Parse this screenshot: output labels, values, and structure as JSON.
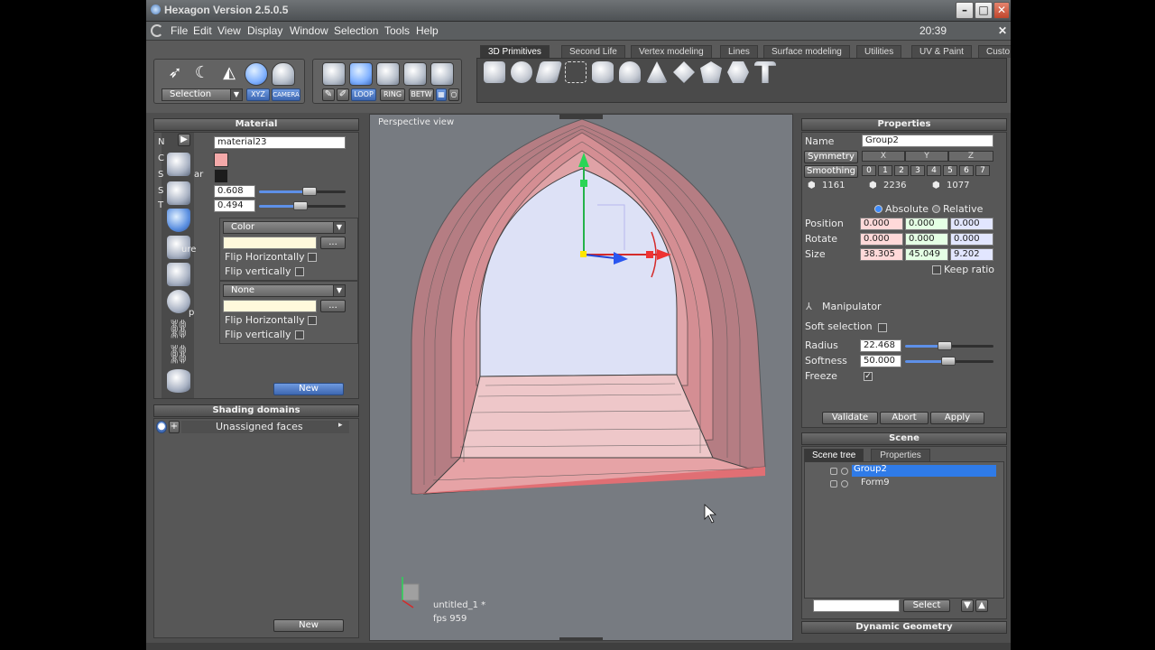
{
  "window": {
    "title": "Hexagon Version 2.5.0.5",
    "clock": "20:39"
  },
  "menu": [
    "File",
    "Edit",
    "View",
    "Display",
    "Window",
    "Selection",
    "Tools",
    "Help"
  ],
  "toolbar": {
    "selection_mode": "Selection",
    "xyz": "XYZ",
    "camera": "CAMERA",
    "loop": "LOOP",
    "ring": "RING",
    "betw": "BETW"
  },
  "tabs": [
    "3D Primitives",
    "Second Life",
    "Vertex modeling",
    "Lines",
    "Surface modeling",
    "Utilities",
    "UV & Paint",
    "Custo"
  ],
  "material_panel": {
    "header": "Material",
    "name_value": "material23",
    "row_labels": [
      "N",
      "C",
      "S",
      "S",
      "T"
    ],
    "row_label_suffix": "ar",
    "color_swatch": "#f4a9a9",
    "specular_swatch": "#1c1c1c",
    "shininess": "0.608",
    "transparency": "0.494",
    "shininess_level": 0.55,
    "transparency_level": 0.45,
    "texture_label_suffix": "ure",
    "bump_label_suffix": "p",
    "texture_mode": "Color",
    "bump_mode": "None",
    "flip_h": "Flip Horizontally",
    "flip_v": "Flip vertically",
    "new_button": "New"
  },
  "shading_panel": {
    "header": "Shading domains",
    "item": "Unassigned faces",
    "new_button": "New"
  },
  "viewport": {
    "label": "Perspective view",
    "file": "untitled_1 *",
    "fps": "fps 959"
  },
  "properties": {
    "header": "Properties",
    "name_label": "Name",
    "name_value": "Group2",
    "symmetry_label": "Symmetry",
    "symmetry_axes": [
      "X",
      "Y",
      "Z"
    ],
    "smoothing_label": "Smoothing",
    "smoothing_levels": [
      "0",
      "1",
      "2",
      "3",
      "4",
      "5",
      "6",
      "7"
    ],
    "stats": [
      "1161",
      "2236",
      "1077"
    ],
    "absolute": "Absolute",
    "relative": "Relative",
    "position_label": "Position",
    "position": [
      "0.000",
      "0.000",
      "0.000"
    ],
    "rotate_label": "Rotate",
    "rotate": [
      "0.000",
      "0.000",
      "0.000"
    ],
    "size_label": "Size",
    "size": [
      "38.305",
      "45.049",
      "9.202"
    ],
    "keep_ratio": "Keep ratio",
    "manipulator": "Manipulator",
    "soft_selection": "Soft selection",
    "radius_label": "Radius",
    "radius": "22.468",
    "radius_level": 0.45,
    "softness_label": "Softness",
    "softness": "50.000",
    "softness_level": 0.5,
    "freeze": "Freeze",
    "validate": "Validate",
    "abort": "Abort",
    "apply": "Apply"
  },
  "scene": {
    "header": "Scene",
    "tab_tree": "Scene tree",
    "tab_properties": "Properties",
    "items": [
      "Group2",
      "Form9"
    ],
    "select_button": "Select"
  },
  "dynamic_geometry": {
    "header": "Dynamic Geometry"
  },
  "colors": {
    "accent": "#3d8bfd",
    "selected_row": "#2f7be8",
    "arch": "#e97f85"
  }
}
